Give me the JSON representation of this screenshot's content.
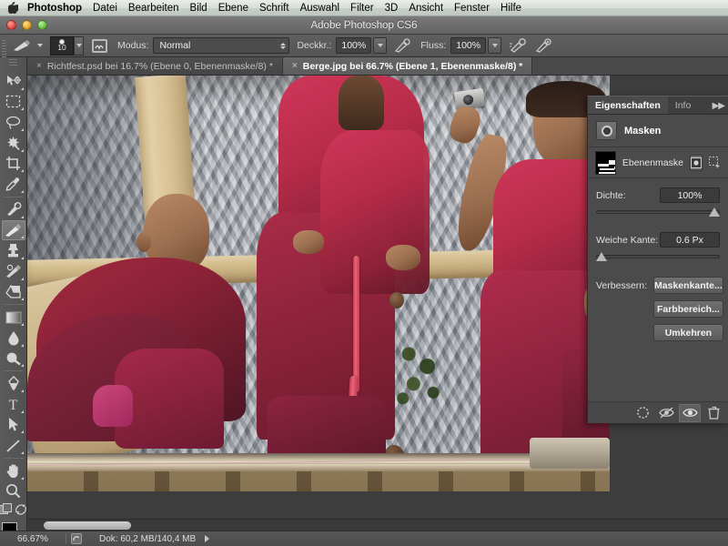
{
  "macbar": {
    "apple_icon": "apple-logo-icon",
    "items": [
      {
        "label": "Photoshop",
        "bold": true
      },
      {
        "label": "Datei",
        "bold": false
      },
      {
        "label": "Bearbeiten",
        "bold": false
      },
      {
        "label": "Bild",
        "bold": false
      },
      {
        "label": "Ebene",
        "bold": false
      },
      {
        "label": "Schrift",
        "bold": false
      },
      {
        "label": "Auswahl",
        "bold": false
      },
      {
        "label": "Filter",
        "bold": false
      },
      {
        "label": "3D",
        "bold": false
      },
      {
        "label": "Ansicht",
        "bold": false
      },
      {
        "label": "Fenster",
        "bold": false
      },
      {
        "label": "Hilfe",
        "bold": false
      }
    ]
  },
  "titlebar": {
    "title": "Adobe Photoshop CS6",
    "close_label": "",
    "minimize_label": "",
    "zoom_label": ""
  },
  "options_bar": {
    "brush_preset_icon": "brush-stroke-icon",
    "brush_size": "10",
    "airbrush_toggle_icon": "brush-panel-icon",
    "mode_label": "Modus:",
    "mode_value": "Normal",
    "opacity_label": "Deckkr.:",
    "opacity_value": "100%",
    "opacity_pressure_icon": "pressure-opacity-icon",
    "flow_label": "Fluss:",
    "flow_value": "100%",
    "airbrush_icon": "airbrush-icon",
    "pressure_size_icon": "pressure-size-icon"
  },
  "tabs": [
    {
      "title": "Richtfest.psd bei 16.7% (Ebene 0, Ebenenmaske/8) *",
      "close": "×",
      "active": false
    },
    {
      "title": "Berge.jpg bei 66.7% (Ebene 1, Ebenenmaske/8) *",
      "close": "×",
      "active": true
    }
  ],
  "tools": [
    {
      "name": "move-tool",
      "icon": "move-icon",
      "active": false,
      "submenu": true
    },
    {
      "name": "marquee-tool",
      "icon": "rectangular-marquee-icon",
      "active": false,
      "submenu": true
    },
    {
      "name": "lasso-tool",
      "icon": "lasso-icon",
      "active": false,
      "submenu": true
    },
    {
      "name": "magic-wand-tool",
      "icon": "magic-wand-icon",
      "active": false,
      "submenu": true
    },
    {
      "name": "crop-tool",
      "icon": "crop-icon",
      "active": false,
      "submenu": true
    },
    {
      "name": "eyedropper-tool",
      "icon": "eyedropper-icon",
      "active": false,
      "submenu": true
    },
    {
      "name": "healing-brush-tool",
      "icon": "healing-brush-icon",
      "active": false,
      "submenu": true
    },
    {
      "name": "brush-tool",
      "icon": "brush-icon",
      "active": true,
      "submenu": true
    },
    {
      "name": "clone-stamp-tool",
      "icon": "clone-stamp-icon",
      "active": false,
      "submenu": true
    },
    {
      "name": "history-brush-tool",
      "icon": "history-brush-icon",
      "active": false,
      "submenu": true
    },
    {
      "name": "eraser-tool",
      "icon": "eraser-icon",
      "active": false,
      "submenu": true
    },
    {
      "name": "gradient-tool",
      "icon": "gradient-icon",
      "active": false,
      "submenu": true
    },
    {
      "name": "blur-tool",
      "icon": "blur-droplet-icon",
      "active": false,
      "submenu": true
    },
    {
      "name": "dodge-tool",
      "icon": "dodge-icon",
      "active": false,
      "submenu": true
    },
    {
      "name": "pen-tool",
      "icon": "pen-icon",
      "active": false,
      "submenu": true
    },
    {
      "name": "type-tool",
      "icon": "type-t-icon",
      "active": false,
      "submenu": true
    },
    {
      "name": "path-selection-tool",
      "icon": "path-arrow-icon",
      "active": false,
      "submenu": true
    },
    {
      "name": "line-tool",
      "icon": "line-icon",
      "active": false,
      "submenu": true
    },
    {
      "name": "hand-tool",
      "icon": "hand-icon",
      "active": false,
      "submenu": true
    },
    {
      "name": "zoom-tool",
      "icon": "magnifier-icon",
      "active": false,
      "submenu": false
    }
  ],
  "tool_footer": {
    "quickmask_icon": "quick-mask-icon",
    "swap_icon": "swap-colors-icon",
    "foreground_color": "#000000",
    "background_color": "#ffffff"
  },
  "properties_panel": {
    "tabs": [
      {
        "label": "Eigenschaften",
        "active": true
      },
      {
        "label": "Info",
        "active": false
      }
    ],
    "collapse_icon": "collapse-panel-icon",
    "header_title": "Masken",
    "header_icon": "pixel-mask-icon",
    "mask_name": "Ebenenmaske",
    "mask_thumb_icon": "layer-mask-thumbnail",
    "mask_select_icon": "pixel-mask-select-icon",
    "mask_add_icon": "vector-mask-add-icon",
    "density": {
      "label": "Dichte:",
      "value": "100%",
      "position_pct": 100
    },
    "feather": {
      "label": "Weiche Kante:",
      "value": "0.6 Px",
      "position_pct": 4
    },
    "refine_label": "Verbessern:",
    "buttons": [
      {
        "label": "Maskenkante...",
        "name": "mask-edge-button"
      },
      {
        "label": "Farbbereich...",
        "name": "color-range-button"
      },
      {
        "label": "Umkehren",
        "name": "invert-button"
      }
    ],
    "footer_icons": [
      {
        "name": "load-selection-icon",
        "active": false
      },
      {
        "name": "apply-mask-icon",
        "active": false
      },
      {
        "name": "toggle-mask-visibility-icon",
        "active": true
      },
      {
        "name": "delete-mask-icon",
        "active": false
      }
    ]
  },
  "status_bar": {
    "zoom": "66.67%",
    "doc_icon": "document-info-icon",
    "doc_info": "Dok: 60,2 MB/140,4 MB",
    "expand_icon": "status-expand-arrow-icon"
  },
  "scrollbars": {
    "horizontal_name": "horizontal-scrollbar",
    "thumb_name": "horizontal-scroll-thumb"
  }
}
